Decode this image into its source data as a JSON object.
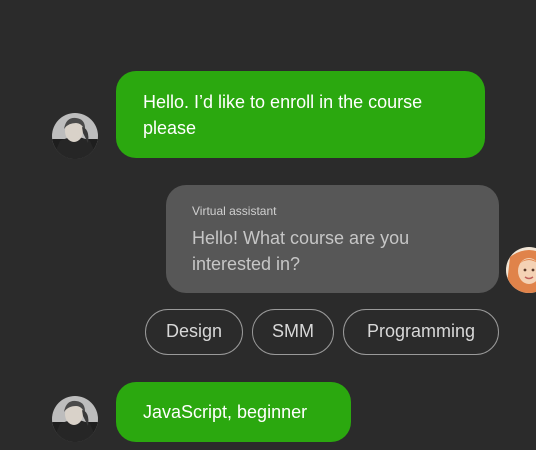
{
  "messages": [
    {
      "from": "user",
      "text": "Hello. I’d like to enroll in the course please"
    },
    {
      "from": "assistant",
      "sender": "Virtual assistant",
      "text": "Hello! What course are you interested in?"
    },
    {
      "from": "user",
      "text": "JavaScript, beginner"
    }
  ],
  "quick_replies": [
    "Design",
    "SMM",
    "Programming"
  ],
  "colors": {
    "background": "#2b2b2b",
    "user_bubble": "#2ba80f",
    "assistant_bubble": "#575757",
    "chip_border": "#9a9a9a"
  },
  "icons": {
    "user_avatar": "user-photo-avatar",
    "assistant_avatar": "assistant-photo-avatar"
  }
}
